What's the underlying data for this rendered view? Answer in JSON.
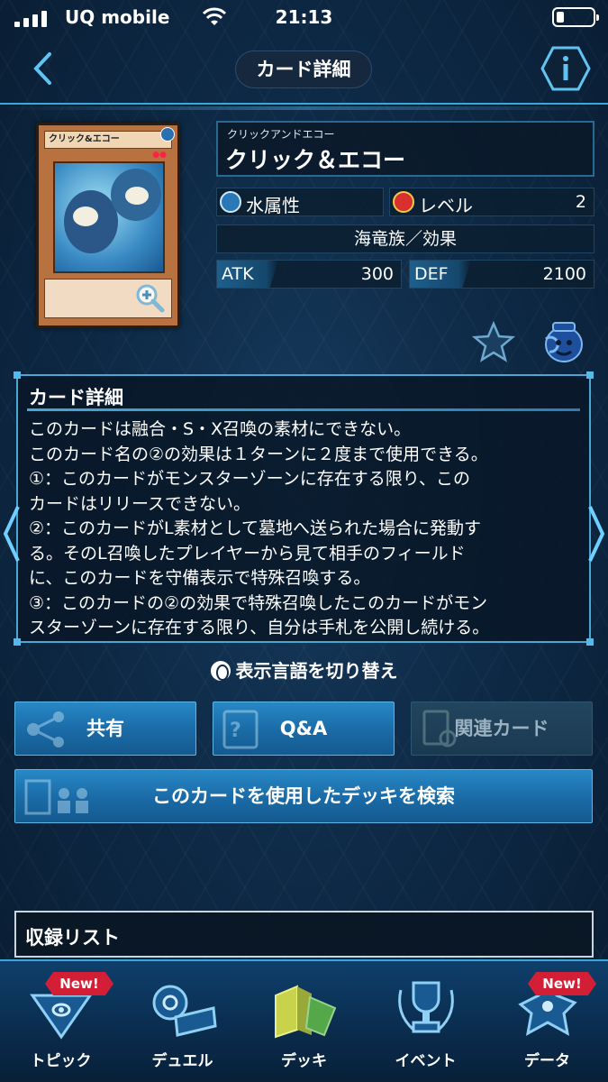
{
  "status_bar": {
    "carrier": "UQ mobile",
    "time": "21:13"
  },
  "header": {
    "title": "カード詳細",
    "back_icon": "chevron-left-icon",
    "info_icon": "info-hexagon-icon"
  },
  "card": {
    "thumbnail_name": "クリック&エコー",
    "kana": "クリックアンドエコー",
    "name": "クリック＆エコー",
    "attribute": "水属性",
    "level_label": "レベル",
    "level": "2",
    "type": "海竜族／効果",
    "atk_label": "ATK",
    "atk": "300",
    "def_label": "DEF",
    "def": "2100"
  },
  "detail": {
    "title": "カード詳細",
    "text": "このカードは融合・S・X召喚の素材にできない。\nこのカード名の②の効果は１ターンに２度まで使用できる。\n①：このカードがモンスターゾーンに存在する限り、この\nカードはリリースできない。\n②：このカードがL素材として墓地へ送られた場合に発動す\nる。そのL召喚したプレイヤーから見て相手のフィールド\nに、このカードを守備表示で特殊召喚する。\n③：このカードの②の効果で特殊召喚したこのカードがモン\nスターゾーンに存在する限り、自分は手札を公開し続ける。"
  },
  "language_toggle": "表示言語を切り替え",
  "buttons": {
    "share": "共有",
    "qa": "Q&A",
    "related": "関連カード",
    "deck_search": "このカードを使用したデッキを検索"
  },
  "record_list": "収録リスト",
  "nav": [
    {
      "label": "トピック",
      "badge": "New!",
      "icon": "topic-pyramid-icon"
    },
    {
      "label": "デュエル",
      "badge": "",
      "icon": "duel-disk-icon"
    },
    {
      "label": "デッキ",
      "badge": "",
      "icon": "deck-cards-icon"
    },
    {
      "label": "イベント",
      "badge": "",
      "icon": "event-trophy-icon"
    },
    {
      "label": "データ",
      "badge": "New!",
      "icon": "data-dragon-icon"
    }
  ],
  "colors": {
    "accent": "#3aa7d8",
    "button": "#1a6aa6",
    "badge": "#d21f35"
  }
}
